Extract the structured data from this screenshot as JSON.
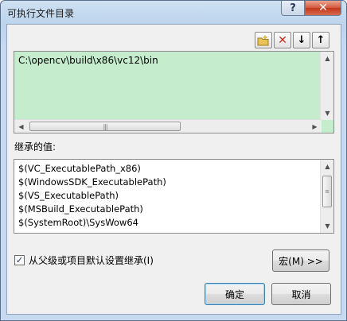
{
  "window": {
    "title": "可执行文件目录"
  },
  "caption": {
    "help_glyph": "?",
    "close_glyph": "✕"
  },
  "toolbar": {
    "new_line_icon": "folder-new-icon",
    "delete_icon": "delete-icon",
    "move_down_icon": "arrow-down-icon",
    "move_up_icon": "arrow-up-icon",
    "delete_glyph": "✕",
    "down_glyph": "↓",
    "up_glyph": "↑"
  },
  "editor": {
    "value": "C:\\opencv\\build\\x86\\vc12\\bin"
  },
  "inherited": {
    "label": "继承的值:",
    "items": [
      "$(VC_ExecutablePath_x86)",
      "$(WindowsSDK_ExecutablePath)",
      "$(VS_ExecutablePath)",
      "$(MSBuild_ExecutablePath)",
      "$(SystemRoot)\\SysWow64"
    ]
  },
  "inherit_checkbox": {
    "label": "从父级或项目默认设置继承(I)",
    "checked": true,
    "check_glyph": "✓"
  },
  "buttons": {
    "macros": "宏(M) >>",
    "ok": "确定",
    "cancel": "取消"
  },
  "colors": {
    "editor_bg": "#c5edcd",
    "close_red": "#c2381c",
    "title_bar": "#bcd4ec"
  }
}
